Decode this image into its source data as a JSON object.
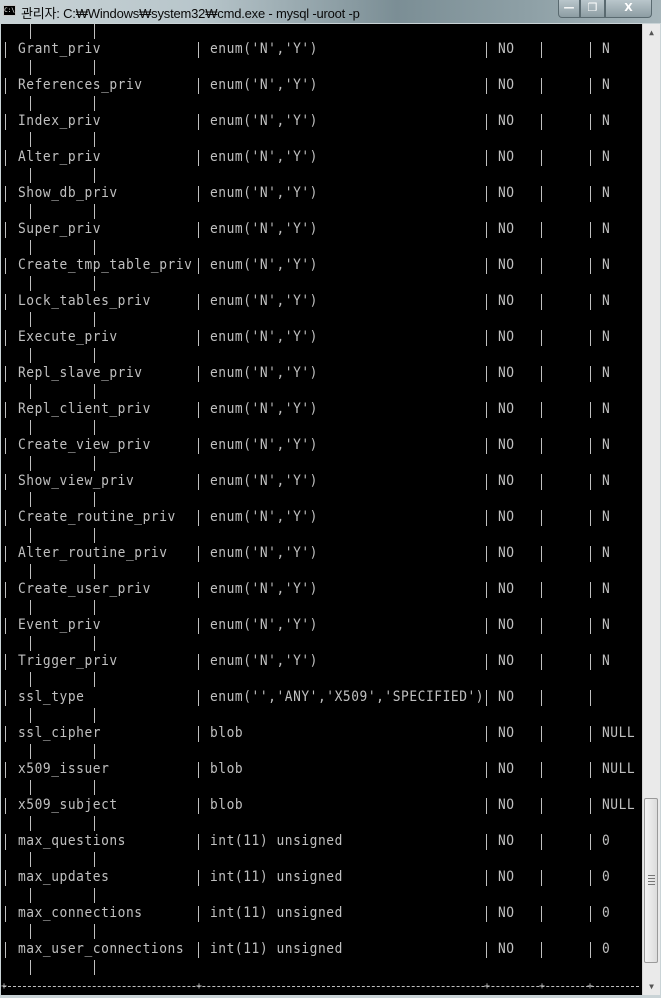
{
  "window": {
    "title": "관리자: C:₩Windows₩system32₩cmd.exe - mysql  -uroot -p",
    "app_icon_text": "C:\\",
    "minimize_glyph": "—",
    "maximize_glyph": "❐",
    "close_glyph": "X"
  },
  "console": {
    "text_color": "#c0c0c0",
    "background": "#000000",
    "rows": [
      {
        "field": "Grant_priv",
        "type": "enum('N','Y')",
        "null": "NO",
        "key": "",
        "default": "N"
      },
      {
        "field": "References_priv",
        "type": "enum('N','Y')",
        "null": "NO",
        "key": "",
        "default": "N"
      },
      {
        "field": "Index_priv",
        "type": "enum('N','Y')",
        "null": "NO",
        "key": "",
        "default": "N"
      },
      {
        "field": "Alter_priv",
        "type": "enum('N','Y')",
        "null": "NO",
        "key": "",
        "default": "N"
      },
      {
        "field": "Show_db_priv",
        "type": "enum('N','Y')",
        "null": "NO",
        "key": "",
        "default": "N"
      },
      {
        "field": "Super_priv",
        "type": "enum('N','Y')",
        "null": "NO",
        "key": "",
        "default": "N"
      },
      {
        "field": "Create_tmp_table_priv",
        "type": "enum('N','Y')",
        "null": "NO",
        "key": "",
        "default": "N"
      },
      {
        "field": "Lock_tables_priv",
        "type": "enum('N','Y')",
        "null": "NO",
        "key": "",
        "default": "N"
      },
      {
        "field": "Execute_priv",
        "type": "enum('N','Y')",
        "null": "NO",
        "key": "",
        "default": "N"
      },
      {
        "field": "Repl_slave_priv",
        "type": "enum('N','Y')",
        "null": "NO",
        "key": "",
        "default": "N"
      },
      {
        "field": "Repl_client_priv",
        "type": "enum('N','Y')",
        "null": "NO",
        "key": "",
        "default": "N"
      },
      {
        "field": "Create_view_priv",
        "type": "enum('N','Y')",
        "null": "NO",
        "key": "",
        "default": "N"
      },
      {
        "field": "Show_view_priv",
        "type": "enum('N','Y')",
        "null": "NO",
        "key": "",
        "default": "N"
      },
      {
        "field": "Create_routine_priv",
        "type": "enum('N','Y')",
        "null": "NO",
        "key": "",
        "default": "N"
      },
      {
        "field": "Alter_routine_priv",
        "type": "enum('N','Y')",
        "null": "NO",
        "key": "",
        "default": "N"
      },
      {
        "field": "Create_user_priv",
        "type": "enum('N','Y')",
        "null": "NO",
        "key": "",
        "default": "N"
      },
      {
        "field": "Event_priv",
        "type": "enum('N','Y')",
        "null": "NO",
        "key": "",
        "default": "N"
      },
      {
        "field": "Trigger_priv",
        "type": "enum('N','Y')",
        "null": "NO",
        "key": "",
        "default": "N"
      },
      {
        "field": "ssl_type",
        "type": "enum('','ANY','X509','SPECIFIED')",
        "null": "NO",
        "key": "",
        "default": ""
      },
      {
        "field": "ssl_cipher",
        "type": "blob",
        "null": "NO",
        "key": "",
        "default": "NULL"
      },
      {
        "field": "x509_issuer",
        "type": "blob",
        "null": "NO",
        "key": "",
        "default": "NULL"
      },
      {
        "field": "x509_subject",
        "type": "blob",
        "null": "NO",
        "key": "",
        "default": "NULL"
      },
      {
        "field": "max_questions",
        "type": "int(11) unsigned",
        "null": "NO",
        "key": "",
        "default": "0"
      },
      {
        "field": "max_updates",
        "type": "int(11) unsigned",
        "null": "NO",
        "key": "",
        "default": "0"
      },
      {
        "field": "max_connections",
        "type": "int(11) unsigned",
        "null": "NO",
        "key": "",
        "default": "0"
      },
      {
        "field": "max_user_connections",
        "type": "int(11) unsigned",
        "null": "NO",
        "key": "",
        "default": "0"
      }
    ]
  },
  "scrollbar": {
    "up_glyph": "▲",
    "down_glyph": "▼",
    "position_fraction": 0.96
  }
}
